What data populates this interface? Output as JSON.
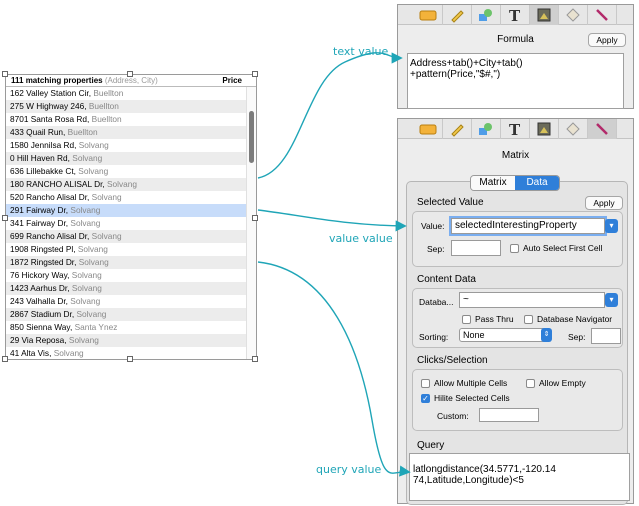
{
  "list": {
    "header": {
      "title": "111 matching properties",
      "subtitle": "(Address, City)",
      "price_label": "Price"
    },
    "rows": [
      {
        "address": "162 Valley Station Cir",
        "city": "Buellton"
      },
      {
        "address": "275 W Highway 246",
        "city": "Buellton"
      },
      {
        "address": "8701 Santa Rosa Rd",
        "city": "Buellton"
      },
      {
        "address": "433 Quail Run",
        "city": "Buellton"
      },
      {
        "address": "1580 Jennilsa Rd",
        "city": "Solvang"
      },
      {
        "address": "0 Hill Haven Rd",
        "city": "Solvang"
      },
      {
        "address": "636 Lillebakke Ct",
        "city": "Solvang"
      },
      {
        "address": "180 RANCHO ALISAL Dr",
        "city": "Solvang"
      },
      {
        "address": "520 Rancho Alisal Dr",
        "city": "Solvang"
      },
      {
        "address": "291 Fairway Dr",
        "city": "Solvang"
      },
      {
        "address": "341 Fairway Dr",
        "city": "Solvang"
      },
      {
        "address": "699 Rancho Alisal Dr",
        "city": "Solvang"
      },
      {
        "address": "1908 Ringsted Pl",
        "city": "Solvang"
      },
      {
        "address": "1872 Ringsted Dr",
        "city": "Solvang"
      },
      {
        "address": "76 Hickory Way",
        "city": "Solvang"
      },
      {
        "address": "1423 Aarhus Dr",
        "city": "Solvang"
      },
      {
        "address": "243 Valhalla Dr",
        "city": "Solvang"
      },
      {
        "address": "2867 Stadium Dr",
        "city": "Solvang"
      },
      {
        "address": "850 Sienna Way",
        "city": "Santa Ynez"
      },
      {
        "address": "29 Via Reposa",
        "city": "Solvang"
      },
      {
        "address": "41 Alta Vis",
        "city": "Solvang"
      }
    ],
    "selected_row": "291 Fairway Dr"
  },
  "formula_panel": {
    "title": "Formula",
    "apply_label": "Apply",
    "formula_line1": "Address+tab()+City+tab()",
    "formula_line2": "+pattern(Price,\"$#,\")"
  },
  "matrix_panel": {
    "title": "Matrix",
    "tabs": {
      "matrix": "Matrix",
      "data": "Data"
    },
    "apply_label": "Apply",
    "selected_value": {
      "title": "Selected Value",
      "value_label": "Value:",
      "value": "selectedInterestingProperty",
      "sep_label": "Sep:",
      "sep_value": "",
      "auto_select_label": "Auto Select First Cell"
    },
    "content_data": {
      "title": "Content Data",
      "database_label": "Databa...",
      "database_value": "~",
      "pass_thru_label": "Pass Thru",
      "database_navigator_label": "Database Navigator",
      "sorting_label": "Sorting:",
      "sorting_value": "None",
      "sep_label": "Sep:"
    },
    "clicks": {
      "title": "Clicks/Selection",
      "allow_multiple_label": "Allow Multiple Cells",
      "allow_empty_label": "Allow Empty",
      "hilite_label": "Hilite Selected Cells",
      "custom_label": "Custom:"
    },
    "query": {
      "title": "Query",
      "line1": "latlongdistance(34.5771,-120.14",
      "line2": "74,Latitude,Longitude)<5"
    }
  },
  "annotations": {
    "text_value": "text value",
    "value_value": "value value",
    "query_value": "query value"
  },
  "colors": {
    "accent": "#2f7fd9",
    "annotation": "#1fa5b7",
    "selection": "#c7dcfa"
  },
  "icons": [
    "button-tool-icon",
    "pencil-tool-icon",
    "shapes-tool-icon",
    "text-tool-icon",
    "image-tool-icon",
    "diamond-tool-icon",
    "wand-tool-icon"
  ]
}
